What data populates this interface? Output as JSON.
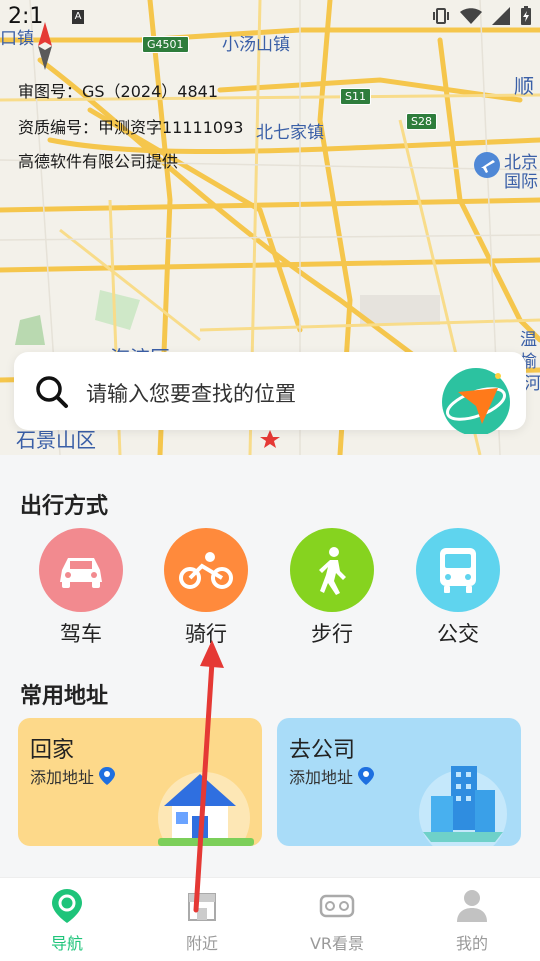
{
  "status": {
    "time": "2:1"
  },
  "map": {
    "info_lines": [
      "审图号：GS（2024）4841",
      "资质编号：甲测资字11111093",
      "高德软件有限公司提供"
    ],
    "places": [
      "小汤山镇",
      "北七家镇",
      "顺",
      "北京",
      "国际",
      "温",
      "榆",
      "河",
      "海淀区",
      "石景山区",
      "口镇"
    ],
    "shields": [
      "G4501",
      "S11",
      "S28"
    ]
  },
  "search": {
    "placeholder": "请输入您要查找的位置"
  },
  "travel": {
    "title": "出行方式",
    "modes": [
      {
        "label": "驾车",
        "icon": "car-icon",
        "color": "#f28a8f"
      },
      {
        "label": "骑行",
        "icon": "bicycle-icon",
        "color": "#ff8a3c"
      },
      {
        "label": "步行",
        "icon": "walking-icon",
        "color": "#86d31f"
      },
      {
        "label": "公交",
        "icon": "bus-icon",
        "color": "#5fd4ee"
      }
    ]
  },
  "addresses": {
    "title": "常用地址",
    "items": [
      {
        "title": "回家",
        "sub": "添加地址",
        "icon": "house-icon",
        "bg": "#fdd98a"
      },
      {
        "title": "去公司",
        "sub": "添加地址",
        "icon": "building-icon",
        "bg": "#a9dcf8"
      }
    ]
  },
  "nav": {
    "items": [
      {
        "label": "导航",
        "icon": "map-pin-icon",
        "active": true
      },
      {
        "label": "附近",
        "icon": "store-icon",
        "active": false
      },
      {
        "label": "VR看景",
        "icon": "vr-headset-icon",
        "active": false
      },
      {
        "label": "我的",
        "icon": "user-icon",
        "active": false
      }
    ],
    "active_color": "#1ec47a",
    "inactive_color": "#9a9a9a"
  }
}
